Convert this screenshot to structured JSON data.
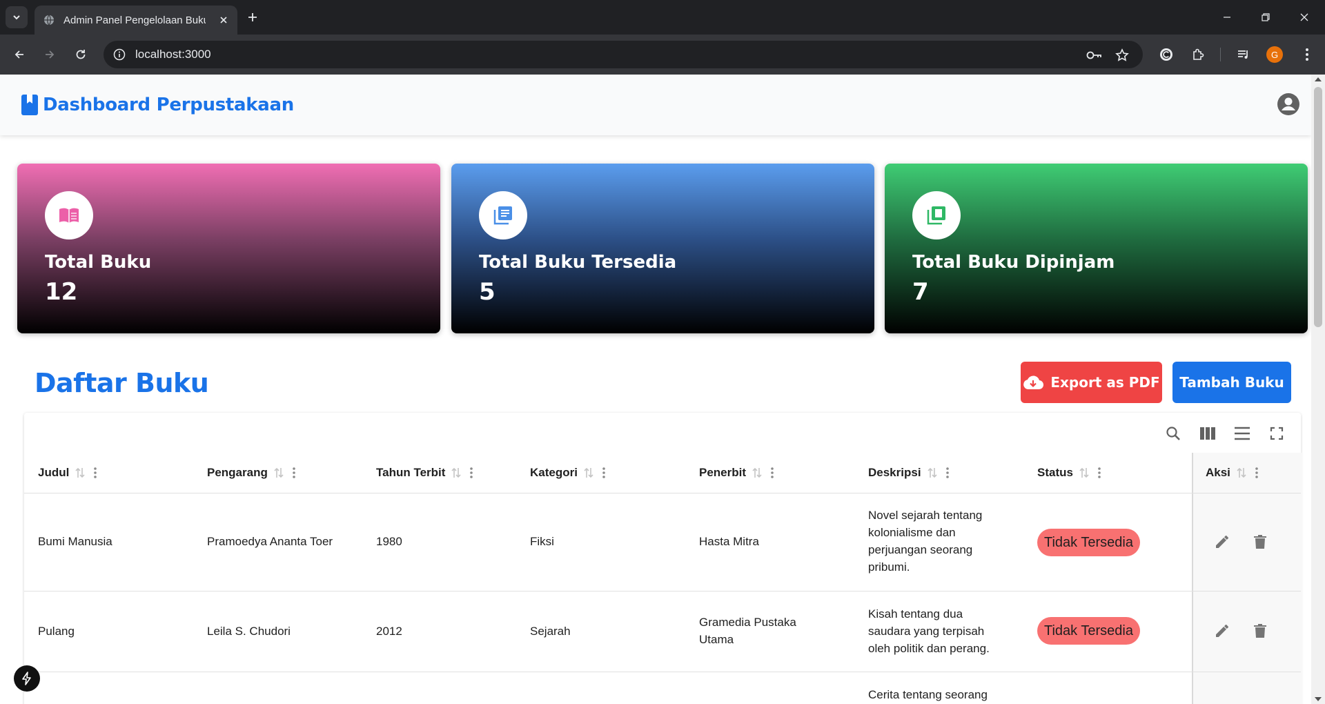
{
  "browser": {
    "tab_title": "Admin Panel Pengelolaan Buku",
    "url": "localhost:3000",
    "profile_initial": "G"
  },
  "header": {
    "brand": "Dashboard Perpustakaan"
  },
  "stats": [
    {
      "label": "Total Buku",
      "value": "12",
      "icon": "book-open-icon"
    },
    {
      "label": "Total Buku Tersedia",
      "value": "5",
      "icon": "library-books-icon"
    },
    {
      "label": "Total Buku Dipinjam",
      "value": "7",
      "icon": "library-add-check-icon"
    }
  ],
  "list": {
    "title": "Daftar Buku",
    "export_label": "Export as PDF",
    "add_label": "Tambah Buku"
  },
  "table": {
    "columns": [
      "Judul",
      "Pengarang",
      "Tahun Terbit",
      "Kategori",
      "Penerbit",
      "Deskripsi",
      "Status",
      "Aksi"
    ],
    "rows": [
      {
        "judul": "Bumi Manusia",
        "pengarang": "Pramoedya Ananta Toer",
        "tahun": "1980",
        "kategori": "Fiksi",
        "penerbit": "Hasta Mitra",
        "deskripsi": [
          "Novel sejarah tentang",
          "kolonialisme dan",
          "perjuangan seorang",
          "pribumi."
        ],
        "status": "Tidak Tersedia"
      },
      {
        "judul": "Pulang",
        "pengarang": "Leila S. Chudori",
        "tahun": "2012",
        "kategori": "Sejarah",
        "penerbit": [
          "Gramedia Pustaka",
          "Utama"
        ],
        "deskripsi": [
          "Kisah tentang dua",
          "saudara yang terpisah",
          "oleh politik dan perang."
        ],
        "status": "Tidak Tersedia"
      },
      {
        "deskripsi": [
          "Cerita tentang seorang"
        ]
      }
    ]
  },
  "colors": {
    "accent": "#1a73e8",
    "danger": "#ef4444",
    "status_unavailable": "#f87171"
  }
}
